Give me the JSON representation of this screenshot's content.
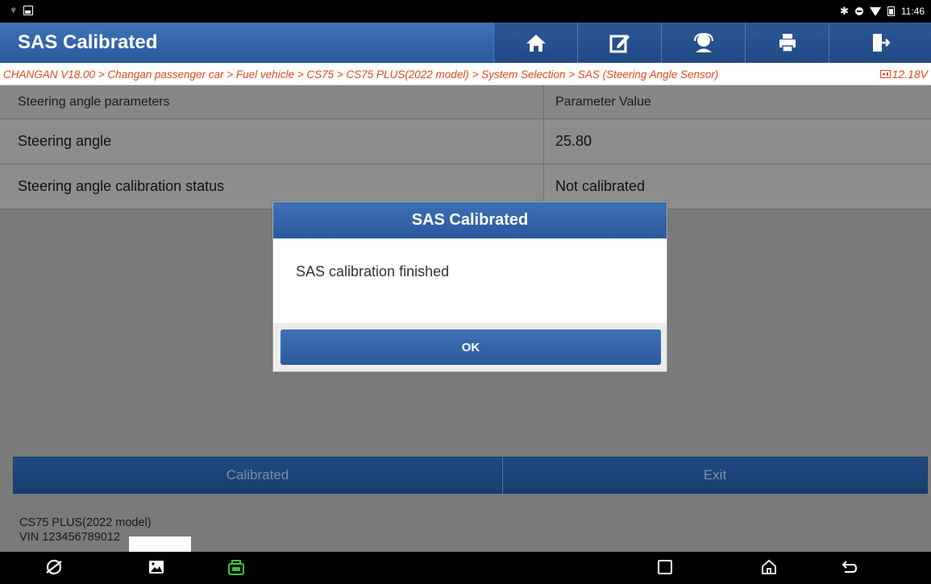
{
  "status_bar": {
    "time": "11:46"
  },
  "header": {
    "title": "SAS Calibrated",
    "tools": [
      "home-icon",
      "report-icon",
      "support-icon",
      "print-icon",
      "exit-icon"
    ]
  },
  "breadcrumb": {
    "path": "CHANGAN V18.00 > Changan passenger car > Fuel vehicle > CS75 > CS75 PLUS(2022 model) > System Selection > SAS (Steering Angle Sensor)",
    "voltage": "12.18V"
  },
  "table": {
    "headers": [
      "Steering angle parameters",
      "Parameter Value"
    ],
    "rows": [
      {
        "name": "Steering angle",
        "value": "25.80"
      },
      {
        "name": "Steering angle calibration status",
        "value": "Not calibrated"
      }
    ]
  },
  "buttons": {
    "calibrated": "Calibrated",
    "exit": "Exit"
  },
  "vehicle": {
    "model": "CS75 PLUS(2022 model)",
    "vin": "VIN 123456789012"
  },
  "dialog": {
    "title": "SAS Calibrated",
    "message": "SAS calibration finished",
    "ok": "OK"
  },
  "colors": {
    "accent": "#2b5a9c",
    "breadcrumb": "#e0491f",
    "vci": "#39c43a"
  }
}
